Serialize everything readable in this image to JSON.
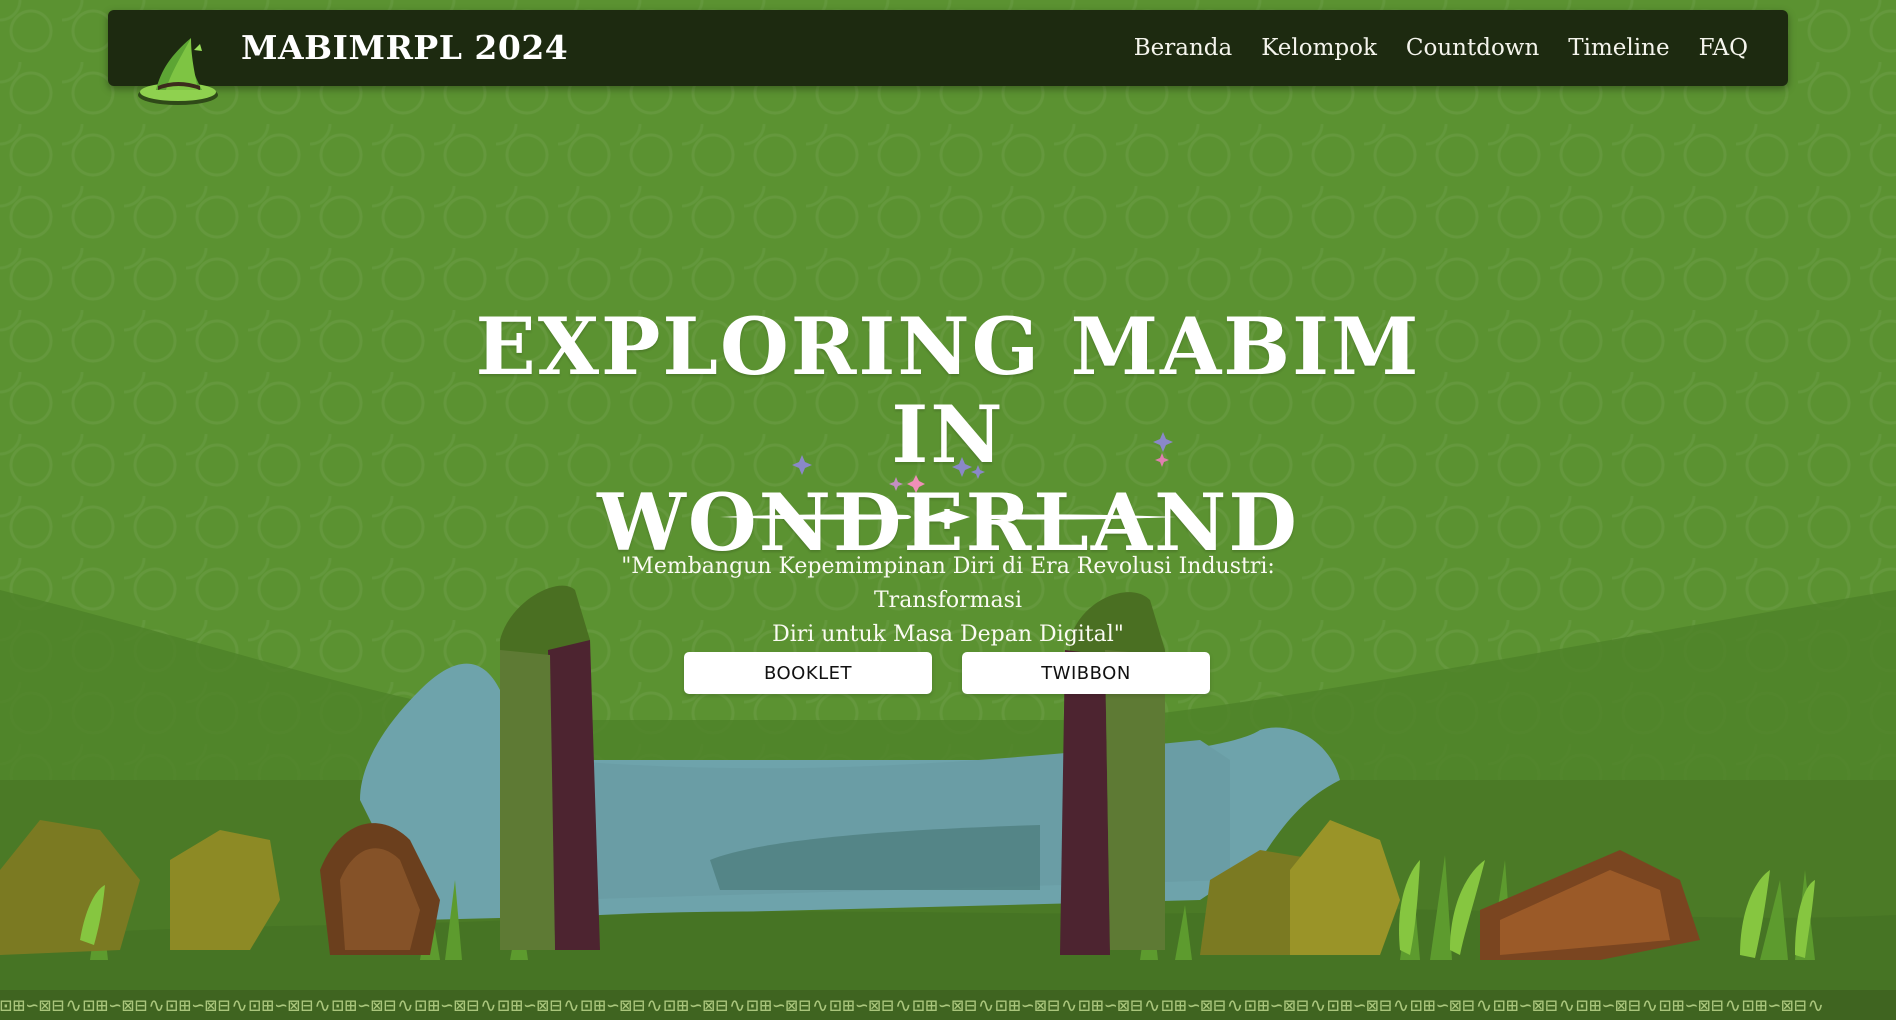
{
  "navbar": {
    "brand": "MABIMRPL 2024",
    "links": [
      "Beranda",
      "Kelompok",
      "Countdown",
      "Timeline",
      "FAQ"
    ]
  },
  "hero": {
    "title_line1": "EXPLORING MABIM IN",
    "title_line2": "WONDERLAND",
    "tagline_line1": "\"Membangun Kepemimpinan Diri di Era Revolusi Industri: Transformasi",
    "tagline_line2": "Diri untuk Masa Depan Digital\"",
    "buttons": {
      "booklet": "BOOKLET",
      "twibbon": "TWIBBON"
    }
  },
  "colors": {
    "background": "#5b9231",
    "navbar": "#1d2a10",
    "text": "#ffffff",
    "button_bg": "#ffffff",
    "water": "#6ea3ab",
    "pillar": "#4d2430",
    "ground": "#3f6420"
  },
  "icons": {
    "logo": "green-witch-hat-icon",
    "divider": "ornamental-divider-icon",
    "sparkle": "sparkle-star-icon"
  }
}
